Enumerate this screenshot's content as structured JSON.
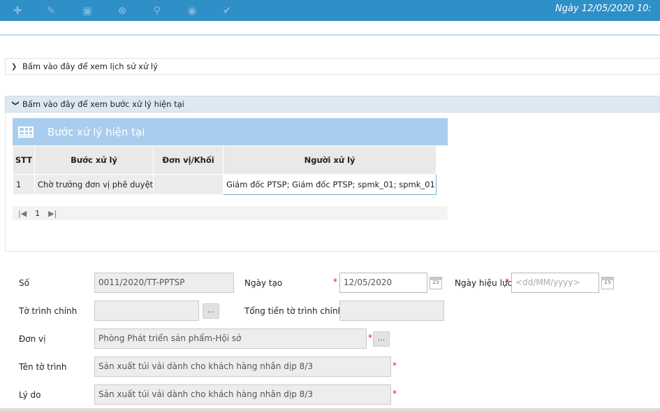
{
  "toolbar": {
    "icons": [
      "plus-icon",
      "edit-icon",
      "save-icon",
      "cancel-icon",
      "search-icon",
      "view-icon",
      "approve-icon"
    ],
    "date_text": "Ngày 12/05/2020  10:"
  },
  "history_panel": {
    "label": "Bấm vào đây để xem lịch sử xử lý"
  },
  "current_panel": {
    "label": "Bấm vào đây để xem bước xử lý hiện tại",
    "grid_title": "Bước xử lý hiện tại",
    "columns": [
      "STT",
      "Bước xử lý",
      "Đơn vị/Khối",
      "Người xử lý"
    ],
    "rows": [
      {
        "stt": "1",
        "step": "Chờ trưởng đơn vị phê duyệt",
        "unit": "",
        "handler": "Giám đốc PTSP; Giám đốc PTSP; spmk_01; spmk_01"
      }
    ],
    "pager": {
      "page": "1"
    }
  },
  "form": {
    "so": {
      "label": "Số",
      "value": "0011/2020/TT-PPTSP"
    },
    "ngay_tao": {
      "label": "Ngày tạo",
      "value": "12/05/2020",
      "cal": "15"
    },
    "ngay_hieu_luc": {
      "label": "Ngày hiệu lực",
      "placeholder": "<dd/MM/yyyy>",
      "cal": "15"
    },
    "to_trinh_chinh": {
      "label": "Tờ trình chính",
      "value": "",
      "btn": "..."
    },
    "tong_tien": {
      "label": "Tổng tiền tờ trình chính",
      "value": ""
    },
    "don_vi": {
      "label": "Đơn vị",
      "value": "Phòng Phát triển sản phẩm-Hội sở",
      "btn": "..."
    },
    "ten_to_trinh": {
      "label": "Tên tờ trình",
      "value": "Sản xuất túi vải dành cho khách hàng nhân dịp 8/3"
    },
    "ly_do": {
      "label": "Lý do",
      "value": "Sản xuất túi vải dành cho khách hàng nhân dịp 8/3"
    },
    "required_mark": "*"
  },
  "colors": {
    "topbar": "#2f8fc7",
    "grid_header": "#a9cdee",
    "required": "#d21f1f"
  }
}
